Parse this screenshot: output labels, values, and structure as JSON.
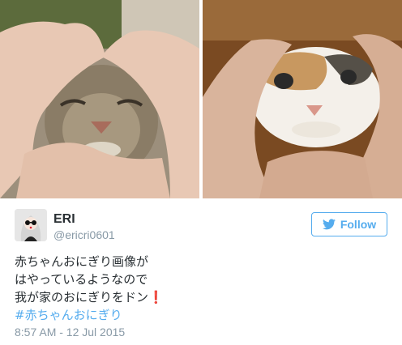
{
  "author": {
    "name": "ERI",
    "handle": "@ericri0601"
  },
  "follow": {
    "label": "Follow",
    "icon": "twitter-bird-icon"
  },
  "tweet": {
    "lines": [
      "赤ちゃんおにぎり画像が",
      "はやっているようなので",
      "我が家のおにぎりをドン"
    ],
    "emoji": "❗",
    "hashtag": "#赤ちゃんおにぎり",
    "timestamp": "8:57 AM - 12 Jul 2015"
  },
  "colors": {
    "accent": "#55acee",
    "text": "#292f33",
    "muted": "#8899a6",
    "exclaim": "#e0243a"
  }
}
